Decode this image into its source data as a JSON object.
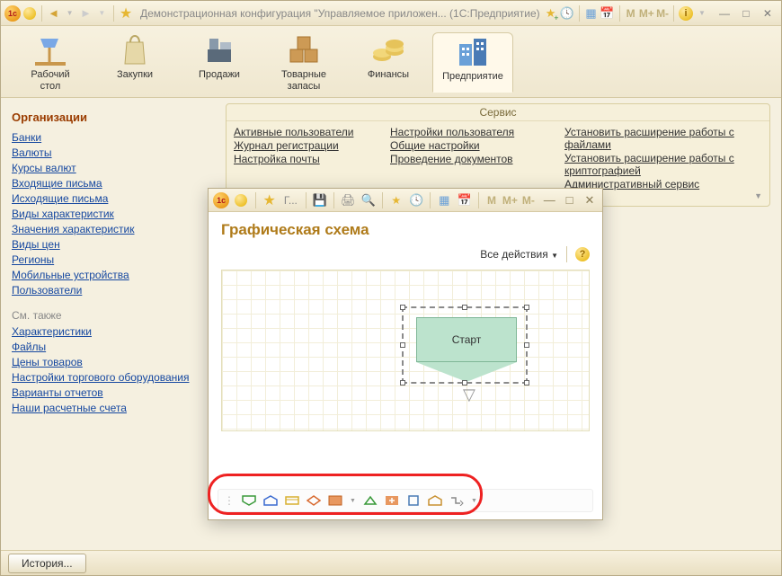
{
  "titlebar": {
    "title": "Демонстрационная конфигурация \"Управляемое приложен...  (1С:Предприятие)"
  },
  "sections": [
    {
      "id": "desktop",
      "label": "Рабочий\nстол",
      "active": false
    },
    {
      "id": "purchases",
      "label": "Закупки",
      "active": false
    },
    {
      "id": "sales",
      "label": "Продажи",
      "active": false
    },
    {
      "id": "stock",
      "label": "Товарные\nзапасы",
      "active": false
    },
    {
      "id": "finance",
      "label": "Финансы",
      "active": false
    },
    {
      "id": "enterprise",
      "label": "Предприятие",
      "active": true
    }
  ],
  "nav": {
    "heading": "Организации",
    "links": [
      "Банки",
      "Валюты",
      "Курсы валют",
      "Входящие письма",
      "Исходящие письма",
      "Виды характеристик",
      "Значения характеристик",
      "Виды цен",
      "Регионы",
      "Мобильные устройства",
      "Пользователи"
    ],
    "also_heading": "См. также",
    "also": [
      "Характеристики",
      "Файлы",
      "Цены товаров",
      "Настройки торгового оборудования",
      "Варианты отчетов",
      "Наши расчетные счета"
    ]
  },
  "service": {
    "title": "Сервис",
    "col1": [
      "Активные пользователи",
      "Журнал регистрации",
      "Настройка почты"
    ],
    "col2": [
      "Настройки пользователя",
      "Общие настройки",
      "Проведение документов"
    ],
    "col3": [
      "Установить расширение работы с файлами",
      "Установить расширение работы с криптографией",
      "Административный сервис"
    ]
  },
  "subwindow": {
    "tab": "Г...",
    "heading": "Графическая схема",
    "all_actions": "Все действия",
    "start_label": "Старт"
  },
  "statusbar": {
    "history": "История..."
  }
}
